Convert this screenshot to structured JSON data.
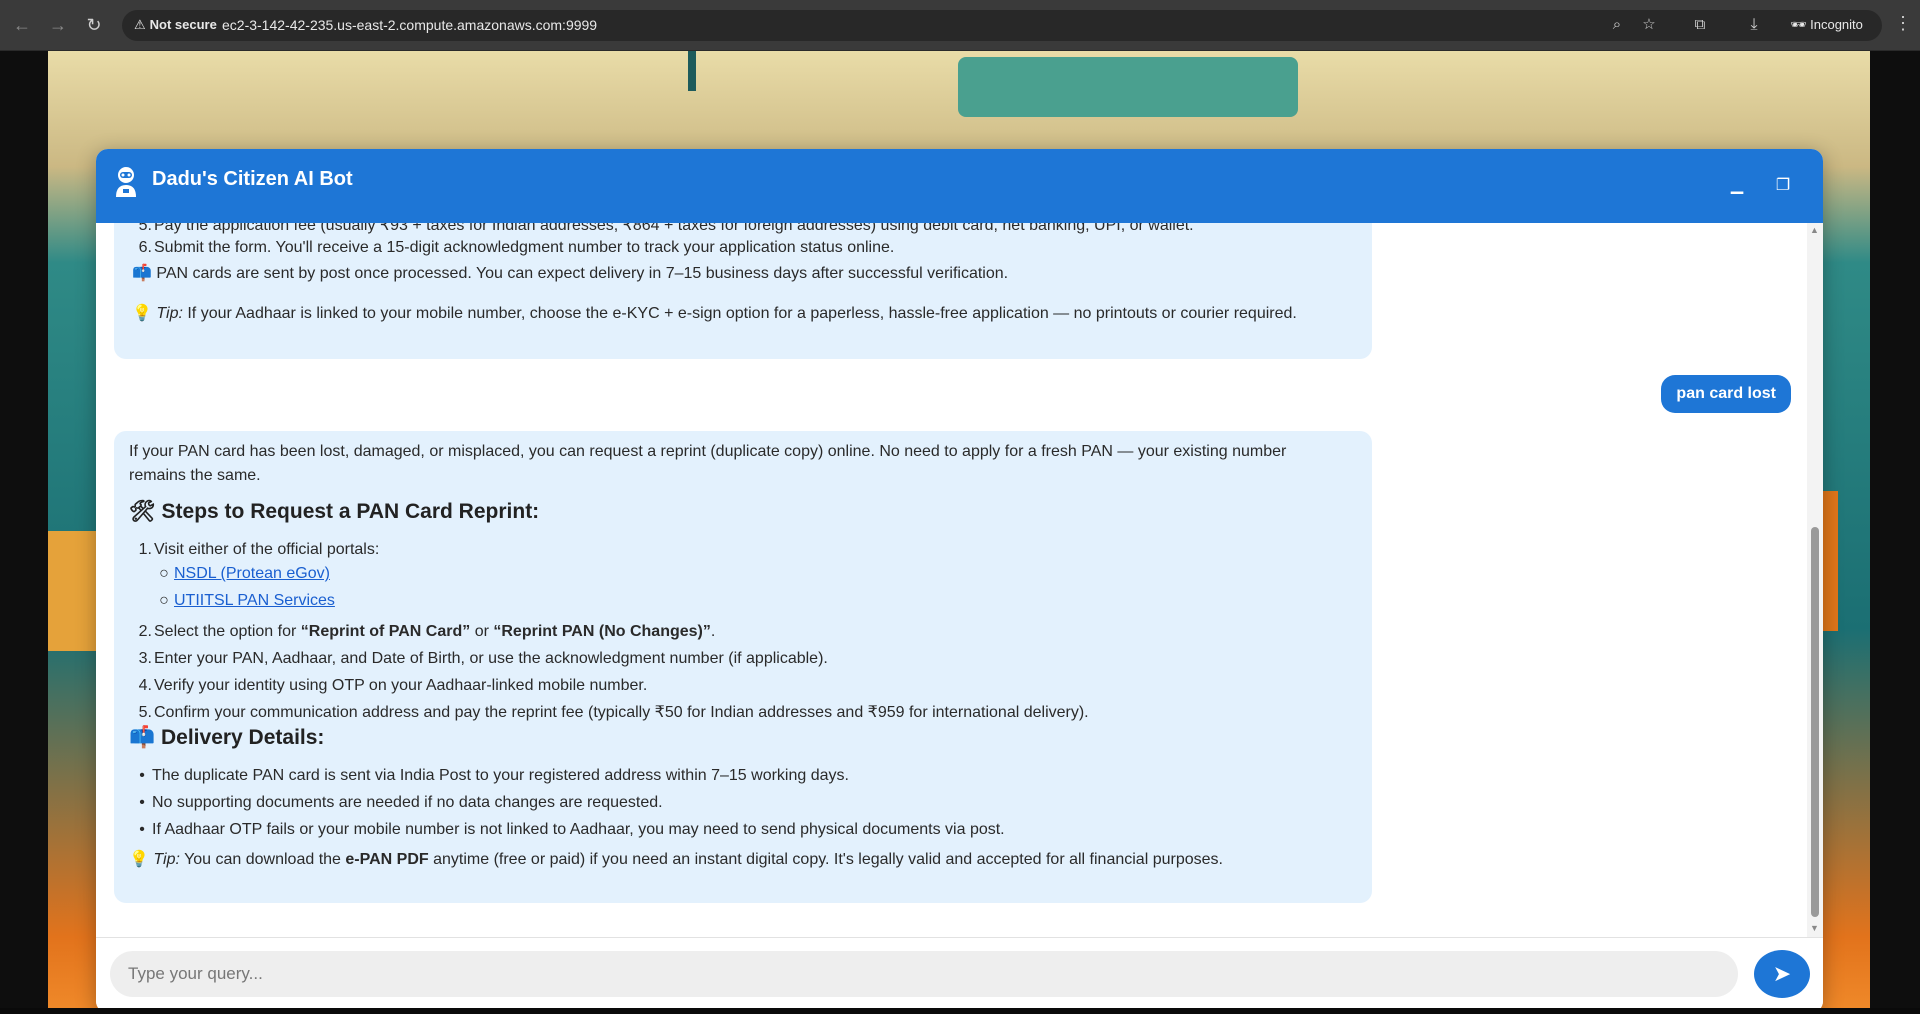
{
  "browser": {
    "not_secure": "Not secure",
    "url": "ec2-3-142-42-235.us-east-2.compute.amazonaws.com:9999",
    "incognito": "Incognito"
  },
  "chat": {
    "title": "Dadu's Citizen AI Bot",
    "prev_message": {
      "item5": "Pay the application fee (usually ₹93 + taxes for Indian addresses, ₹864 + taxes for foreign addresses) using debit card, net banking, UPI, or wallet.",
      "item6_num": "6.",
      "item6": "Submit the form. You'll receive a 15-digit acknowledgment number to track your application status online.",
      "delivery_note": "PAN cards are sent by post once processed. You can expect delivery in 7–15 business days after successful verification.",
      "tip_label": "Tip:",
      "tip_text": "If your Aadhaar is linked to your mobile number, choose the e-KYC + e-sign option for a paperless, hassle-free application — no printouts or courier required."
    },
    "user_message": "pan card lost",
    "reply": {
      "intro_line1": "If your PAN card has been lost, damaged, or misplaced, you can request a reprint (duplicate copy) online. No need to apply for a fresh PAN — your existing number",
      "intro_line2": "remains the same.",
      "steps_heading": "Steps to Request a PAN Card Reprint:",
      "steps": [
        {
          "num": "1.",
          "text": "Visit either of the official portals:"
        },
        {
          "num": "2.",
          "pre": "Select the option for ",
          "bold1": "“Reprint of PAN Card”",
          "mid": " or ",
          "bold2": "“Reprint PAN (No Changes)”",
          "post": "."
        },
        {
          "num": "3.",
          "text": "Enter your PAN, Aadhaar, and Date of Birth, or use the acknowledgment number (if applicable)."
        },
        {
          "num": "4.",
          "text": "Verify your identity using OTP on your Aadhaar-linked mobile number."
        },
        {
          "num": "5.",
          "text": "Confirm your communication address and pay the reprint fee (typically ₹50 for Indian addresses and ₹959 for international delivery)."
        }
      ],
      "portals": [
        "NSDL (Protean eGov)",
        "UTIITSL PAN Services"
      ],
      "delivery_heading": "Delivery Details:",
      "delivery_items": [
        "The duplicate PAN card is sent via India Post to your registered address within 7–15 working days.",
        "No supporting documents are needed if no data changes are requested.",
        "If Aadhaar OTP fails or your mobile number is not linked to Aadhaar, you may need to send physical documents via post."
      ],
      "tip_label": "Tip:",
      "tip_pre": "You can download the ",
      "tip_bold": "e-PAN PDF",
      "tip_post": " anytime (free or paid) if you need an instant digital copy. It's legally valid and accepted for all financial purposes."
    },
    "input_placeholder": "Type your query..."
  },
  "colors": {
    "header": "#1e76d6",
    "bot_bubble": "#e3f1fd",
    "link": "#1a5fd0"
  }
}
